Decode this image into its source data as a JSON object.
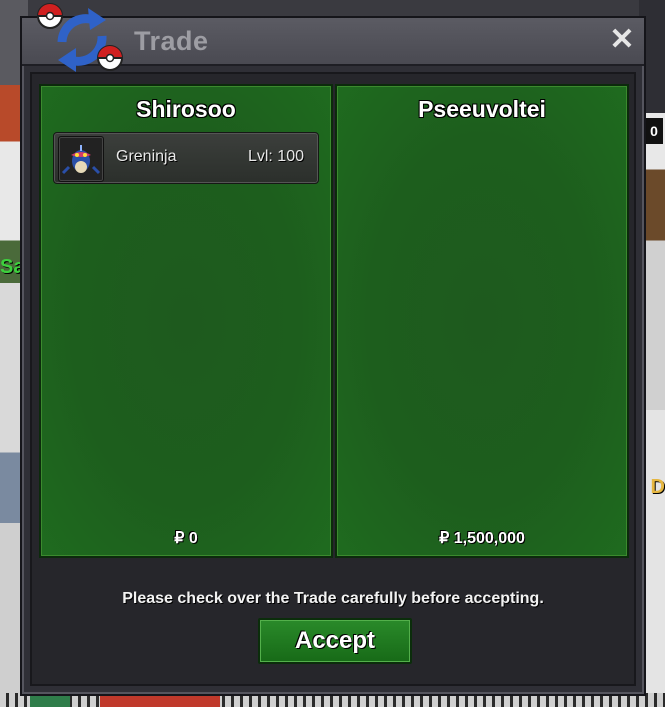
{
  "window": {
    "title": "Trade",
    "close_label": "✕"
  },
  "panels": [
    {
      "player": "Shirosoo",
      "items": [
        {
          "name": "Greninja",
          "level": "Lvl: 100"
        }
      ],
      "money": "₽ 0"
    },
    {
      "player": "Pseeuvoltei",
      "items": [],
      "money": "₽ 1,500,000"
    }
  ],
  "notice": "Please check over the Trade carefully before accepting.",
  "accept_label": "Accept",
  "background": {
    "left_fragment": "Sa",
    "right_fragment": "D",
    "right_sign": "0"
  },
  "colors": {
    "panel_green": "#1d5e1d",
    "accept_green": "#1f7a1f",
    "title_gray": "#9d9da3"
  }
}
